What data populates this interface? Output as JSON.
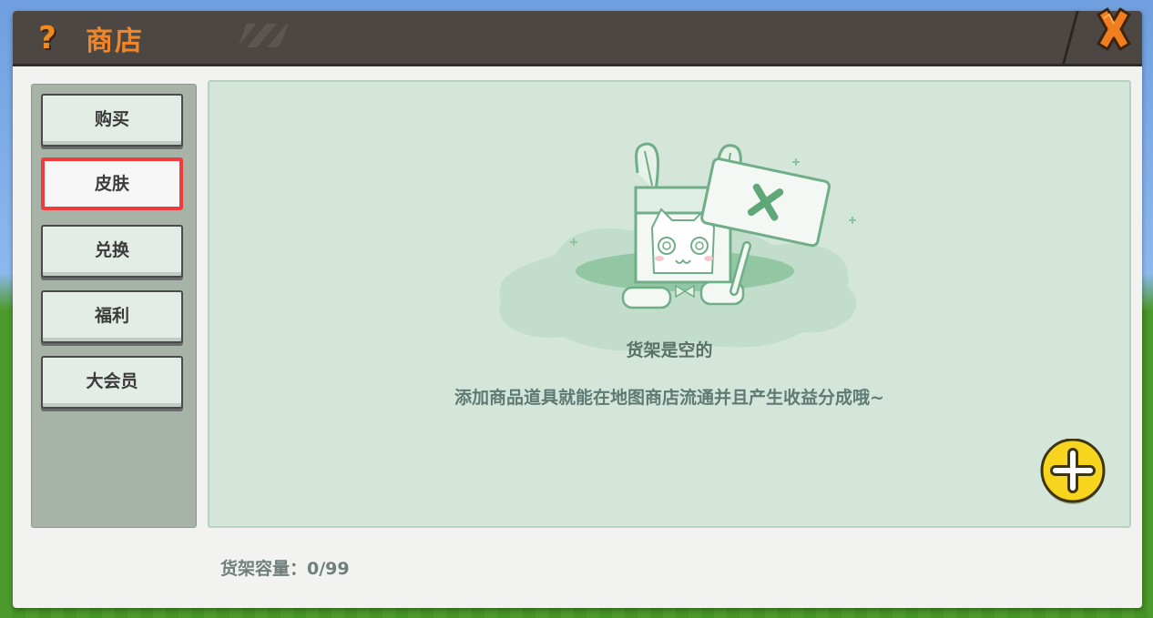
{
  "window": {
    "title": "商店",
    "help_icon": "question-mark-icon",
    "close_icon": "close-x-icon"
  },
  "sidebar": {
    "items": [
      {
        "label": "购买"
      },
      {
        "label": "皮肤",
        "selected": true
      },
      {
        "label": "兑换"
      },
      {
        "label": "福利"
      },
      {
        "label": "大会员"
      }
    ]
  },
  "main": {
    "empty_title": "货架是空的",
    "empty_description": "添加商品道具就能在地图商店流通并且产生收益分成哦~",
    "add_icon": "plus-icon",
    "capacity_label": "货架容量：0/99"
  },
  "colors": {
    "accent_orange": "#f0862a",
    "selected_border": "#ef3b3b",
    "add_button_yellow": "#f7d51e",
    "panel_green": "#d3e6d9"
  }
}
